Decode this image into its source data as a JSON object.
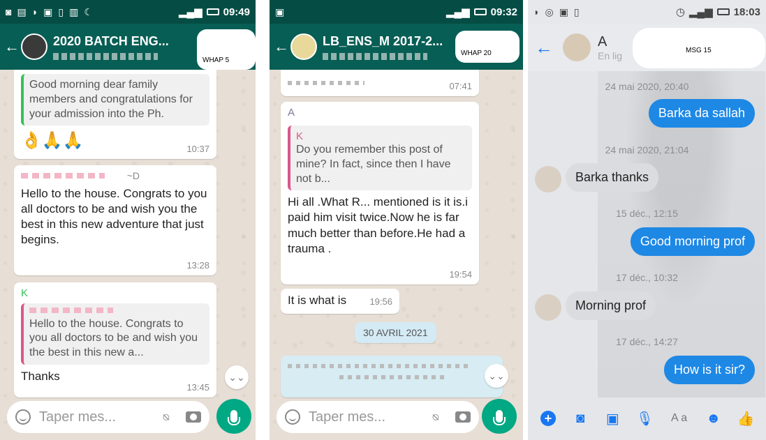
{
  "panel1": {
    "status_time": "09:49",
    "title": "2020 BATCH ENG...",
    "overlay_label": "WHAP 5",
    "messages": [
      {
        "quote": "Good morning dear family members and congratulations for your admission into the Ph.",
        "emoji": "👌🙏🙏",
        "time": "10:37"
      },
      {
        "sender": "~D",
        "text": "Hello to the house. Congrats to you all doctors to be and wish you the best in this new adventure that just begins.",
        "time": "13:28"
      },
      {
        "sender": "K",
        "quote": "Hello to the house. Congrats to you all doctors to be and wish you the best in this new a...",
        "text": "Thanks",
        "time": "13:45"
      }
    ],
    "composer_placeholder": "Taper mes..."
  },
  "panel2": {
    "status_time": "09:32",
    "title": "LB_ENS_M 2017-2...",
    "overlay_label": "WHAP 20",
    "messages": [
      {
        "time": "07:41"
      },
      {
        "sender": "A",
        "quote_sender": "K",
        "quote": "Do you remember this post of mine? In fact, since then I have not b...",
        "text": "Hi all .What R... mentioned is it is.i paid him visit twice.Now he is far much better than before.He had a trauma .",
        "time": "19:54"
      },
      {
        "text": "It is what is",
        "time": "19:56"
      }
    ],
    "date_chip": "30 AVRIL 2021",
    "composer_placeholder": "Taper mes..."
  },
  "panel3": {
    "status_time": "18:03",
    "contact_initial": "A",
    "contact_sub": "En lig",
    "overlay_label": "MSG 15",
    "timestamps": [
      "24 mai 2020, 20:40",
      "24 mai 2020, 21:04",
      "15 déc., 12:15",
      "17 déc., 10:32",
      "17 déc., 14:27"
    ],
    "messages": [
      {
        "text": "Barka da sallah",
        "dir": "out"
      },
      {
        "text": "Barka thanks",
        "dir": "in"
      },
      {
        "text": "Good morning prof",
        "dir": "out"
      },
      {
        "text": "Morning prof",
        "dir": "in"
      },
      {
        "text": "How is it sir?",
        "dir": "out"
      }
    ],
    "toolbar_aa": "A a"
  },
  "colors": {
    "wa_header": "#075e54",
    "wa_status": "#054d44",
    "wa_fab": "#00a884",
    "messenger_blue": "#1e88e5"
  }
}
